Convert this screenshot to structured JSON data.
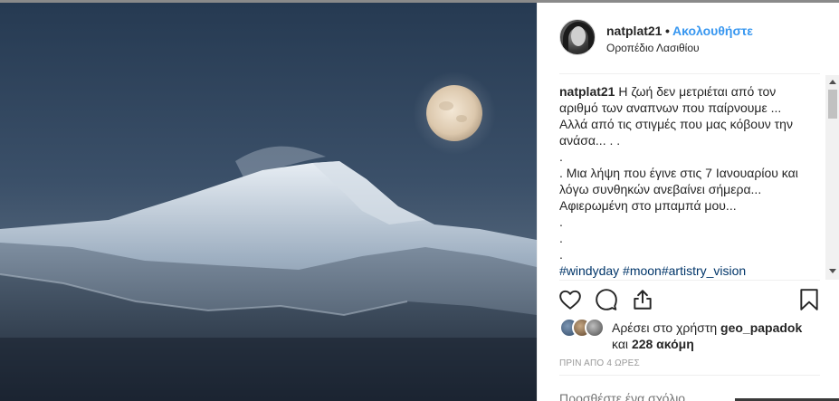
{
  "post": {
    "username": "natplat21",
    "separator": "•",
    "follow_label": "Ακολουθήστε",
    "location": "Οροπέδιο Λασιθίου",
    "caption_user": "natplat21",
    "caption_text": " Η ζωή δεν μετριέται από τον αριθμό των αναπνων που παίρνουμε ... Αλλά από τις στιγμές που μας κόβουν την ανάσα... . .\n.\n. Μια λήψη που έγινε στις 7 Ιανουαρίου και λόγω συνθηκών ανεβαίνει σήμερα... Αφιερωμένη στο μπαμπά μου...\n.\n.\n.",
    "hashtags": "#windyday #moon#artistry_vision",
    "likes_prefix": "Αρέσει στο χρήστη ",
    "likes_user": "geo_papadok",
    "likes_and": "και ",
    "likes_count": "228 ακόμη",
    "timestamp": "ΠΡΙΝ ΑΠΟ 4 ΩΡΕΣ",
    "comment_placeholder": "Προσθέστε ένα σχόλιο..."
  },
  "icons": {
    "like": "heart-icon",
    "comment": "comment-icon",
    "share": "share-icon",
    "save": "bookmark-icon"
  },
  "colors": {
    "link": "#3897f0",
    "hashtag": "#003569",
    "text": "#262626",
    "muted": "#999999"
  }
}
